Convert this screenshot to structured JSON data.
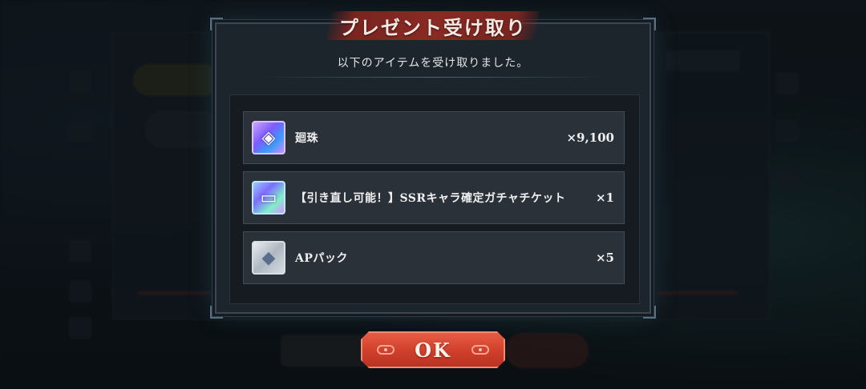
{
  "dialog": {
    "title": "プレゼント受け取り",
    "subtitle": "以下のアイテムを受け取りました。"
  },
  "items": [
    {
      "name": "廻珠",
      "quantity": "×9,100",
      "icon": "orb-icon"
    },
    {
      "name": "【引き直し可能！】SSRキャラ確定ガチャチケット",
      "quantity": "×1",
      "icon": "ticket-icon"
    },
    {
      "name": "APパック",
      "quantity": "×5",
      "icon": "ap-pack-icon"
    }
  ],
  "ok_button": {
    "label": "OK"
  },
  "colors": {
    "title_banner": "#8a2a24",
    "ok_button": "#cf3f2b",
    "dialog_bg": "#1c242c",
    "item_bg": "#2a3139"
  }
}
